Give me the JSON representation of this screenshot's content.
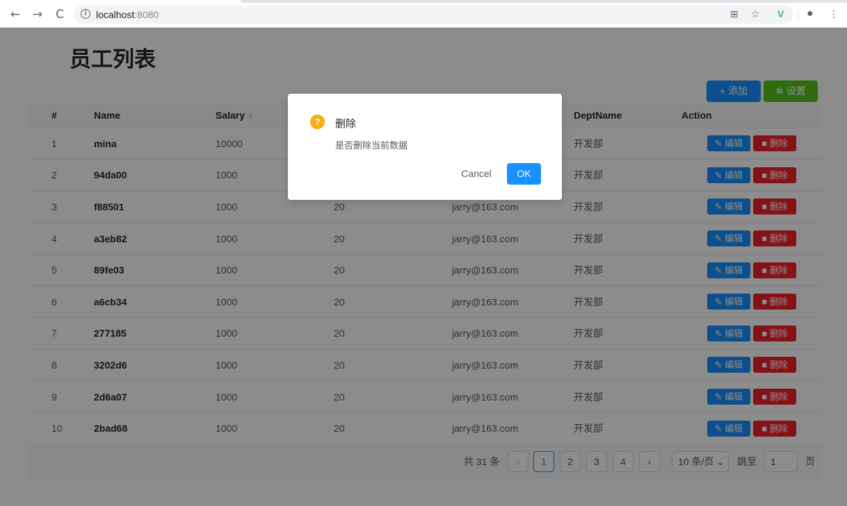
{
  "browser": {
    "url_host": "localhost",
    "url_port": ":8080"
  },
  "page": {
    "title": "员工列表",
    "add_label": "+ 添加",
    "settings_label": "设置"
  },
  "table": {
    "headers": [
      "#",
      "Name",
      "Salary",
      "",
      "",
      "DeptName",
      "Action"
    ],
    "rows": [
      {
        "idx": "1",
        "name": "mina",
        "salary": "10000",
        "age": "",
        "email": "",
        "dept": "开发部"
      },
      {
        "idx": "2",
        "name": "94da00",
        "salary": "1000",
        "age": "",
        "email": "",
        "dept": "开发部"
      },
      {
        "idx": "3",
        "name": "f88501",
        "salary": "1000",
        "age": "20",
        "email": "jarry@163.com",
        "dept": "开发部"
      },
      {
        "idx": "4",
        "name": "a3eb82",
        "salary": "1000",
        "age": "20",
        "email": "jarry@163.com",
        "dept": "开发部"
      },
      {
        "idx": "5",
        "name": "89fe03",
        "salary": "1000",
        "age": "20",
        "email": "jarry@163.com",
        "dept": "开发部"
      },
      {
        "idx": "6",
        "name": "a6cb34",
        "salary": "1000",
        "age": "20",
        "email": "jarry@163.com",
        "dept": "开发部"
      },
      {
        "idx": "7",
        "name": "277185",
        "salary": "1000",
        "age": "20",
        "email": "jarry@163.com",
        "dept": "开发部"
      },
      {
        "idx": "8",
        "name": "3202d6",
        "salary": "1000",
        "age": "20",
        "email": "jarry@163.com",
        "dept": "开发部"
      },
      {
        "idx": "9",
        "name": "2d6a07",
        "salary": "1000",
        "age": "20",
        "email": "jarry@163.com",
        "dept": "开发部"
      },
      {
        "idx": "10",
        "name": "2bad68",
        "salary": "1000",
        "age": "20",
        "email": "jarry@163.com",
        "dept": "开发部"
      }
    ],
    "edit_label": "编辑",
    "delete_label": "删除"
  },
  "pagination": {
    "total": "共 31 条",
    "pages": [
      "1",
      "2",
      "3",
      "4"
    ],
    "current": "1",
    "page_size": "10 条/页",
    "jump_label": "跳至",
    "jump_value": "1",
    "page_unit": "页"
  },
  "modal": {
    "title": "删除",
    "content": "是否删除当前数据",
    "cancel_label": "Cancel",
    "ok_label": "OK"
  },
  "colors": {
    "primary": "#1890ff",
    "success": "#52c41a",
    "danger": "#f5222d",
    "warning": "#faad14"
  }
}
